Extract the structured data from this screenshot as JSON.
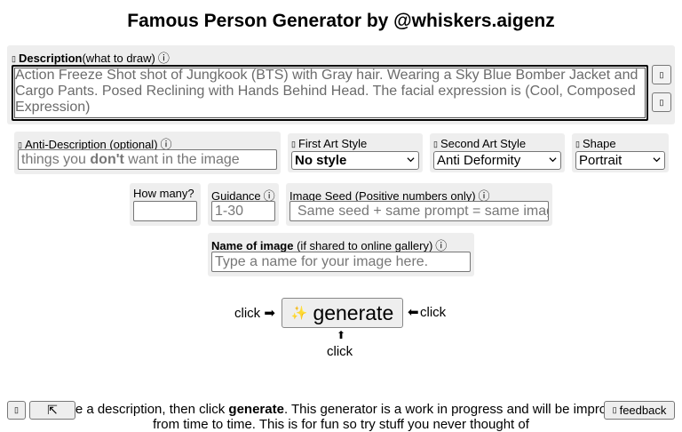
{
  "title": "Famous Person Generator by @whiskers.aigenz",
  "description": {
    "label_bold": "Description",
    "label_rest": "(what to draw)",
    "value": "Action Freeze Shot shot of Jungkook (BTS) with Gray hair. Wearing a Sky Blue Bomber Jacket and Cargo Pants. Posed Reclining with Hands Behind Head. The facial expression is (Cool, Composed Expression)"
  },
  "anti_description": {
    "label": "Anti-Description (optional)",
    "placeholder_before": "things you ",
    "placeholder_bold": "don't",
    "placeholder_after": " want in the image"
  },
  "first_art_style": {
    "label": "First Art Style",
    "selected": "No style"
  },
  "second_art_style": {
    "label": "Second Art Style",
    "selected": "Anti Deformity"
  },
  "shape": {
    "label": "Shape",
    "selected": "Portrait"
  },
  "how_many": {
    "label": "How many?",
    "value": ""
  },
  "guidance": {
    "label": "Guidance",
    "placeholder": "1-30"
  },
  "image_seed": {
    "label": "Image Seed (Positive numbers only)",
    "placeholder": "Same seed + same prompt = same image"
  },
  "image_name": {
    "label_bold": "Name of image",
    "label_rest": " (if shared to online gallery)",
    "placeholder": "Type a name for your image here."
  },
  "generate": {
    "label": "generate",
    "sparkle": "✨",
    "click_left": "click ➡",
    "arrow_right": "⬅",
    "click_right": "click",
    "arrow_up": "⬆",
    "click_bottom": "click"
  },
  "footer": {
    "before": "Type a description, then click ",
    "bold": "generate",
    "after": ". This generator is a work in progress and will be improved",
    "line2": "from time to time. This is for fun so try stuff you never thought of",
    "feedback_label": "feedback",
    "mini_button_2_glyph": "⇱"
  },
  "icons": {
    "info": "ⓘ",
    "glyph": "▯"
  }
}
